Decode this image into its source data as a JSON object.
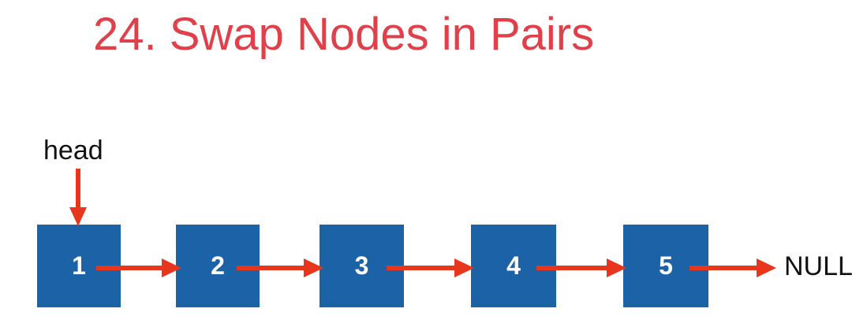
{
  "title": "24. Swap Nodes in Pairs",
  "head_label": "head",
  "null_label": "NULL",
  "nodes": [
    "1",
    "2",
    "3",
    "4",
    "5"
  ],
  "colors": {
    "title": "#e0404a",
    "node_fill": "#1c62a6",
    "node_text": "#ffffff",
    "arrow": "#e8361c",
    "label": "#111111"
  }
}
